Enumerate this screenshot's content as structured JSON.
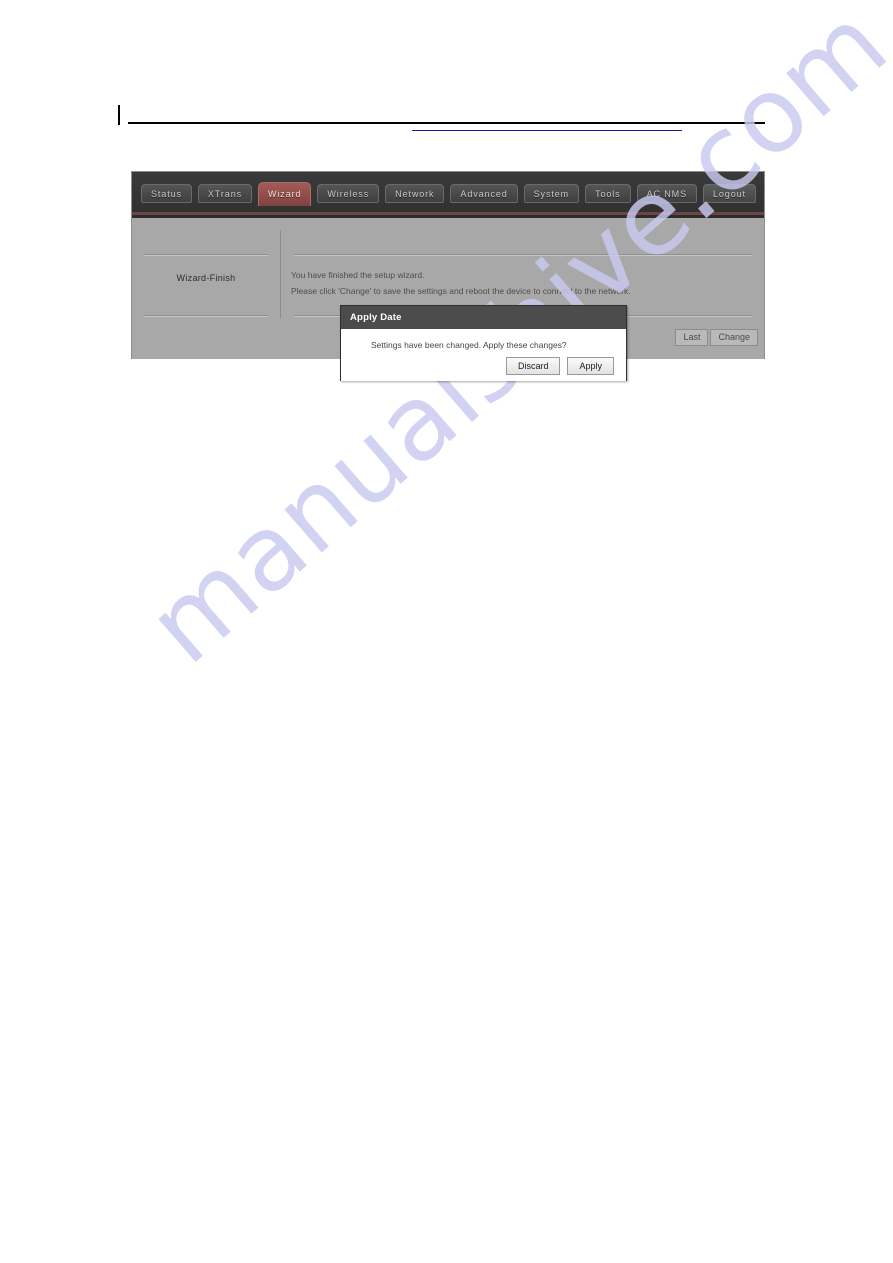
{
  "page": {
    "watermark": "manualshive.com",
    "header_link_text": ""
  },
  "router_ui": {
    "nav": {
      "tabs": [
        {
          "label": "Status",
          "active": false
        },
        {
          "label": "XTrans",
          "active": false
        },
        {
          "label": "Wizard",
          "active": true
        },
        {
          "label": "Wireless",
          "active": false
        },
        {
          "label": "Network",
          "active": false
        },
        {
          "label": "Advanced",
          "active": false
        },
        {
          "label": "System",
          "active": false
        },
        {
          "label": "Tools",
          "active": false
        },
        {
          "label": "AC NMS",
          "active": false
        },
        {
          "label": "Logout",
          "active": false
        }
      ]
    },
    "content": {
      "section_label": "Wizard-Finish",
      "line1": "You have finished the setup wizard.",
      "line2": "Please click 'Change' to save the settings and reboot the device to connect to the network."
    },
    "footer": {
      "last_label": "Last",
      "change_label": "Change"
    }
  },
  "dialog": {
    "title": "Apply Date",
    "message": "Settings have been changed. Apply these changes?",
    "discard_label": "Discard",
    "apply_label": "Apply"
  },
  "colors": {
    "panel_bg": "#a8a8a8",
    "navbar_bg": "#3c3c3c",
    "active_tab": "#94504b",
    "dialog_titlebar": "#4c4c4c",
    "watermark": "#c9c9f0",
    "link": "#1b1b8f"
  }
}
